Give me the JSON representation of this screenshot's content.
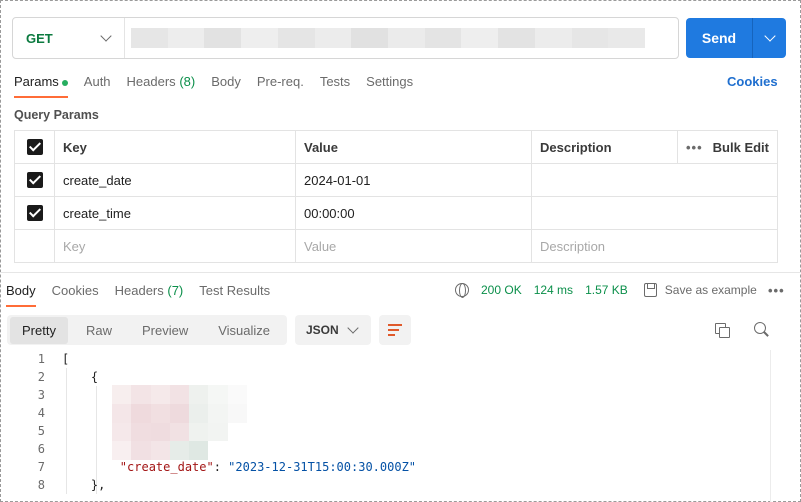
{
  "request": {
    "method": "GET",
    "send_label": "Send"
  },
  "request_tabs": [
    {
      "label": "Params",
      "active": true,
      "dot": true
    },
    {
      "label": "Auth"
    },
    {
      "label": "Headers",
      "count": "(8)"
    },
    {
      "label": "Body"
    },
    {
      "label": "Pre-req."
    },
    {
      "label": "Tests"
    },
    {
      "label": "Settings"
    }
  ],
  "cookies_label": "Cookies",
  "query_params": {
    "title": "Query Params",
    "headers": {
      "key": "Key",
      "value": "Value",
      "description": "Description",
      "bulk_edit": "Bulk Edit"
    },
    "rows": [
      {
        "checked": true,
        "key": "create_date",
        "value": "2024-01-01",
        "description": ""
      },
      {
        "checked": true,
        "key": "create_time",
        "value": "00:00:00",
        "description": ""
      }
    ],
    "placeholders": {
      "key": "Key",
      "value": "Value",
      "description": "Description"
    }
  },
  "response_tabs": [
    {
      "label": "Body",
      "active": true
    },
    {
      "label": "Cookies"
    },
    {
      "label": "Headers",
      "count": "(7)"
    },
    {
      "label": "Test Results"
    }
  ],
  "response_meta": {
    "status": "200 OK",
    "time": "124 ms",
    "size": "1.57 KB",
    "save_label": "Save as example"
  },
  "body_views": [
    "Pretty",
    "Raw",
    "Preview",
    "Visualize"
  ],
  "body_format": "JSON",
  "code": {
    "line_numbers": [
      "1",
      "2",
      "3",
      "4",
      "5",
      "6",
      "7",
      "8"
    ],
    "line1": "[",
    "line2": "    {",
    "line7_key": "\"create_date\"",
    "line7_sep": ": ",
    "line7_val": "\"2023-12-31T15:00:30.000Z\"",
    "line8": "    },"
  },
  "colors": {
    "accent": "#1f7ae0",
    "tab_underline": "#ff6c37",
    "method_get": "#0b7a3f",
    "status_ok": "#0b8f4a"
  }
}
